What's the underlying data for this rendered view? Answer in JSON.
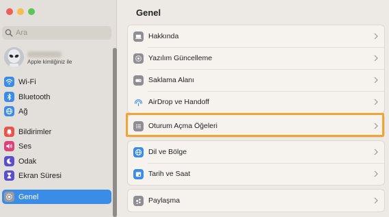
{
  "window": {
    "search_placeholder": "Ara",
    "account_subtitle": "Apple kimliğiniz ile"
  },
  "sidebar": {
    "items": [
      {
        "label": "Wi-Fi",
        "icon": "wifi-icon",
        "color": "#3b8ce6"
      },
      {
        "label": "Bluetooth",
        "icon": "bluetooth-icon",
        "color": "#3b8ce6"
      },
      {
        "label": "Ağ",
        "icon": "globe-icon",
        "color": "#3b8ce6"
      },
      {
        "label": "Bildirimler",
        "icon": "bell-icon",
        "color": "#e8544c"
      },
      {
        "label": "Ses",
        "icon": "speaker-icon",
        "color": "#e0407a"
      },
      {
        "label": "Odak",
        "icon": "moon-icon",
        "color": "#5b4fc9"
      },
      {
        "label": "Ekran Süresi",
        "icon": "hourglass-icon",
        "color": "#5b4fc9"
      },
      {
        "label": "Genel",
        "icon": "gear-icon",
        "color": "#8e8e93",
        "active": true
      }
    ]
  },
  "main": {
    "title": "Genel",
    "rows": [
      {
        "label": "Hakkında",
        "icon": "laptop-icon"
      },
      {
        "label": "Yazılım Güncelleme",
        "icon": "gear-badge-icon"
      },
      {
        "label": "Saklama Alanı",
        "icon": "drive-icon"
      },
      {
        "label": "AirDrop ve Handoff",
        "icon": "airdrop-icon"
      },
      {
        "label": "Oturum Açma Öğeleri",
        "icon": "list-icon"
      },
      {
        "label": "Dil ve Bölge",
        "icon": "globe-icon"
      },
      {
        "label": "Tarih ve Saat",
        "icon": "calendar-icon"
      },
      {
        "label": "Paylaşma",
        "icon": "share-icon"
      }
    ]
  },
  "colors": {
    "accent": "#3b8ce6",
    "highlight": "#f0a431"
  }
}
